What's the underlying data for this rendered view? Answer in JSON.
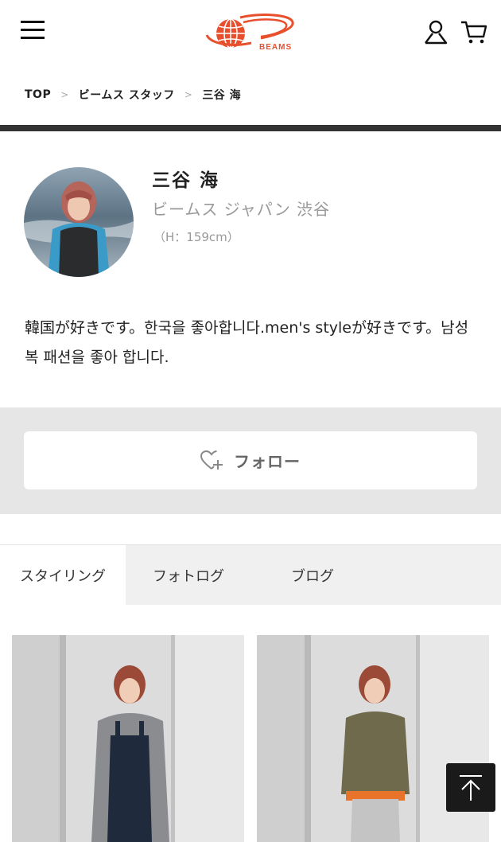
{
  "header": {
    "menu_icon": "hamburger-icon",
    "logo_text": "BEAMS",
    "user_icon": "user-icon",
    "cart_icon": "cart-icon",
    "accent_color": "#e8502d"
  },
  "breadcrumb": {
    "items": [
      "TOP",
      "ビームス スタッフ",
      "三谷 海"
    ],
    "separator": ">"
  },
  "profile": {
    "name": "三谷 海",
    "shop": "ビームス ジャパン 渋谷",
    "height": "（H：159cm）",
    "bio": "韓国が好きです。한국을 좋아합니다.men's styleが好きです。남성복 패션을 좋아 합니다."
  },
  "follow": {
    "label": "フォロー",
    "icon": "heart-plus-icon"
  },
  "tabs": [
    {
      "label": "スタイリング",
      "active": true
    },
    {
      "label": "フォトログ",
      "active": false
    },
    {
      "label": "ブログ",
      "active": false
    }
  ],
  "page_top_icon": "arrow-up-icon"
}
